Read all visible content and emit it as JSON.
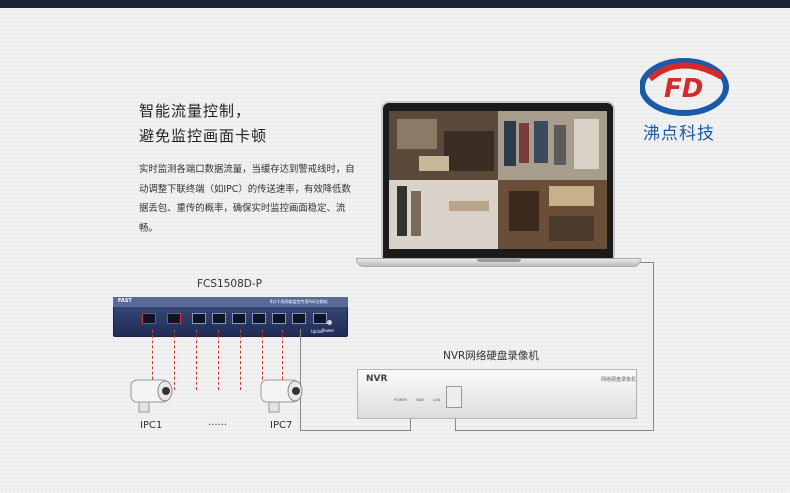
{
  "brand": {
    "name": "沸点科技",
    "logo_letters": "FD",
    "colors": {
      "blue": "#1a5aa8",
      "red": "#d42a2a"
    }
  },
  "headline": {
    "line1": "智能流量控制，",
    "line2": "避免监控画面卡顿"
  },
  "description": {
    "line1": "实时监测各端口数据流量，当缓存达到警戒线时，自",
    "line2": "动调整下联终端（如IPC）的传送速率，有效降低数",
    "line3": "据丢包、重传的概率，确保实时监控画面稳定、流畅。"
  },
  "switch": {
    "model_label": "FCS1508D-P",
    "brand_mark": "FAST",
    "front_text": "8口千兆网络监控专用PoE交换机",
    "power_label": "Power",
    "uplink_label": "Uplink"
  },
  "nvr": {
    "title": "NVR网络硬盘录像机",
    "panel_label": "NVR",
    "panel_small": "网络硬盘录像机",
    "indicators": [
      "POWER",
      "HDD",
      "LAN"
    ]
  },
  "cameras": {
    "left_label": "IPC1",
    "right_label": "IPC7",
    "ellipsis": "......"
  },
  "icons": [
    "fd-logo-icon",
    "laptop-icon",
    "switch-icon",
    "nvr-icon",
    "camera-icon"
  ]
}
